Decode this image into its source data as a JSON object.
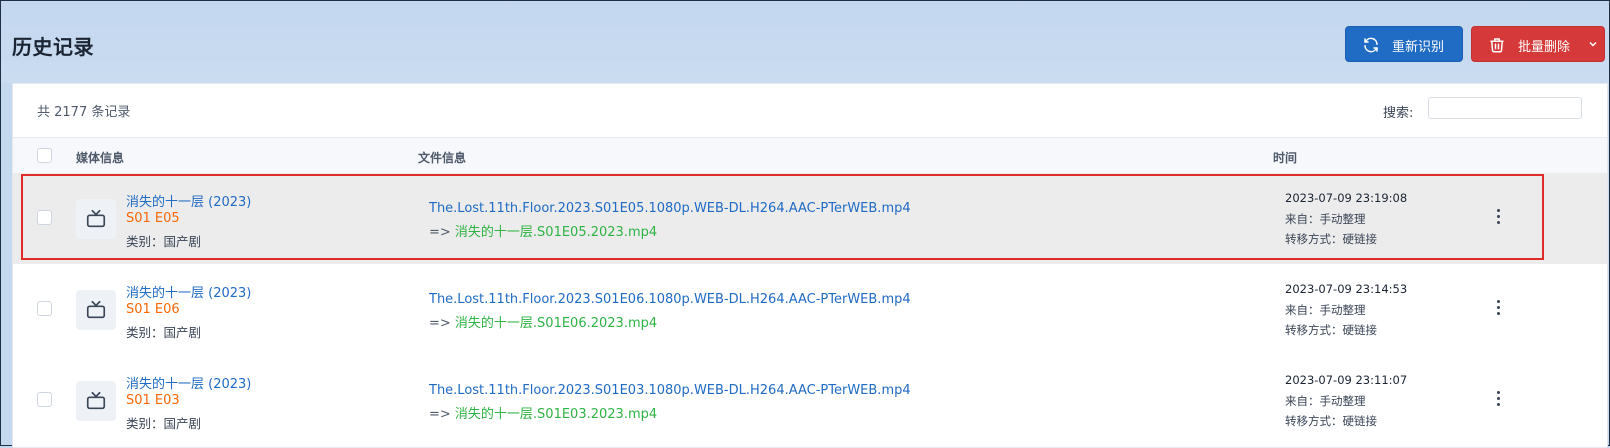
{
  "page": {
    "title": "历史记录"
  },
  "toolbar": {
    "reidentify_label": "重新识别",
    "batch_delete_label": "批量删除",
    "reidentify_color": "#206bc4",
    "delete_color": "#d63939"
  },
  "list": {
    "total_text": "共 2177 条记录",
    "search_label": "搜索:",
    "search_value": "",
    "columns": {
      "media": "媒体信息",
      "file": "文件信息",
      "time": "时间"
    },
    "rows": [
      {
        "title": "消失的十一层 (2023)",
        "episode": "S01 E05",
        "category": "类别：国产剧",
        "source_file": "The.Lost.11th.Floor.2023.S01E05.1080p.WEB-DL.H264.AAC-PTerWEB.mp4",
        "arrow": "=> ",
        "dest_file": "消失的十一层.S01E05.2023.mp4",
        "time": "2023-07-09 23:19:08",
        "from": "来自：手动整理",
        "mode": "转移方式：硬链接",
        "icon": "tv-icon"
      },
      {
        "title": "消失的十一层 (2023)",
        "episode": "S01 E06",
        "category": "类别：国产剧",
        "source_file": "The.Lost.11th.Floor.2023.S01E06.1080p.WEB-DL.H264.AAC-PTerWEB.mp4",
        "arrow": "=> ",
        "dest_file": "消失的十一层.S01E06.2023.mp4",
        "time": "2023-07-09 23:14:53",
        "from": "来自：手动整理",
        "mode": "转移方式：硬链接",
        "icon": "tv-icon"
      },
      {
        "title": "消失的十一层 (2023)",
        "episode": "S01 E03",
        "category": "类别：国产剧",
        "source_file": "The.Lost.11th.Floor.2023.S01E03.1080p.WEB-DL.H264.AAC-PTerWEB.mp4",
        "arrow": "=> ",
        "dest_file": "消失的十一层.S01E03.2023.mp4",
        "time": "2023-07-09 23:11:07",
        "from": "来自：手动整理",
        "mode": "转移方式：硬链接",
        "icon": "tv-icon"
      }
    ]
  }
}
